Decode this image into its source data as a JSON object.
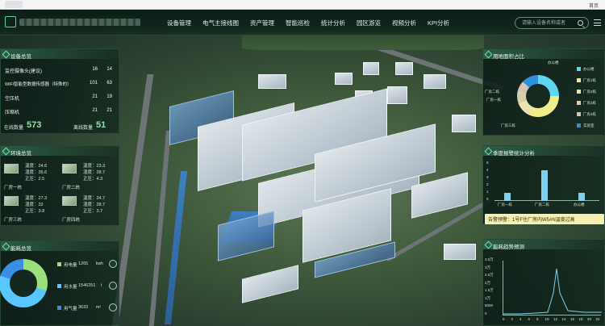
{
  "browser": {
    "tab_right": "首页"
  },
  "header": {
    "nav": [
      "设备管理",
      "电气主接线图",
      "资产管理",
      "智能巡检",
      "统计分析",
      "园区游览",
      "视频分析",
      "KPI分析"
    ],
    "search_placeholder": "请输入设备名称或者"
  },
  "device_panel": {
    "title": "设备总览",
    "rows": [
      {
        "label": "监控摄像头(建议)",
        "a": "16",
        "b": "14"
      },
      {
        "label": "WiFi智能型数据传感器（特殊的）",
        "a": "101",
        "b": "63"
      },
      {
        "label": "空压机",
        "a": "21",
        "b": "19"
      },
      {
        "label": "压缩机",
        "a": "21",
        "b": "21"
      }
    ],
    "online_label": "在线数量",
    "online_value": "573",
    "offline_label": "离线数量",
    "offline_value": "51"
  },
  "env_panel": {
    "title": "环境总览",
    "items": [
      {
        "name": "厂房一栋",
        "temp": "温度：24.6",
        "hum": "湿度：35.6",
        "pm": "正压：2.5"
      },
      {
        "name": "厂房二栋",
        "temp": "温度：23.3",
        "hum": "湿度：28.7",
        "pm": "正压：4.3"
      },
      {
        "name": "厂房三栋",
        "temp": "温度：27.3",
        "hum": "湿度：32",
        "pm": "正压：3.8"
      },
      {
        "name": "厂房四栋",
        "temp": "温度：24.7",
        "hum": "湿度：28.7",
        "pm": "正压：3.7"
      }
    ]
  },
  "energy_panel": {
    "title": "能耗总览",
    "items": [
      {
        "label": "用电量",
        "value": "1265",
        "unit": "kwh",
        "color": "#9be07a"
      },
      {
        "label": "用水量",
        "value": "1546251",
        "unit": "t",
        "color": "#58c7ff"
      },
      {
        "label": "用气量",
        "value": "3633",
        "unit": "m³",
        "color": "#3a8ee6"
      }
    ]
  },
  "usage_panel": {
    "title": "用地面积占比",
    "callouts": [
      "办公楼",
      "厂房二栋",
      "厂房一栋",
      "厂房三栋"
    ],
    "legend": [
      {
        "label": "办公楼",
        "color": "#5fd7f0"
      },
      {
        "label": "厂房1栋",
        "color": "#f0ec8a"
      },
      {
        "label": "厂房2栋",
        "color": "#eae4b0"
      },
      {
        "label": "厂房3栋",
        "color": "#d8d0a8"
      },
      {
        "label": "厂房4栋",
        "color": "#cfc7b4"
      },
      {
        "label": "实验室",
        "color": "#2f8fd8"
      }
    ],
    "shares": [
      0.25,
      0.32,
      0.12,
      0.1,
      0.08,
      0.13
    ]
  },
  "alarm_panel": {
    "title": "季度报警统计分析",
    "categories": [
      "厂房一栋",
      "厂房二栋",
      "办公楼"
    ],
    "y_ticks": [
      "5",
      "4",
      "3",
      "2",
      "1",
      "0"
    ],
    "series": [
      {
        "values": [
          1,
          4,
          1
        ]
      },
      {
        "values": [
          0,
          0,
          0
        ]
      }
    ],
    "alert_text": "告警预警：1号F住厂房内W5#N温度过高"
  },
  "trend_panel": {
    "title": "能耗趋势预测",
    "y_ticks": [
      "3.5万",
      "3万",
      "2.5万",
      "2万",
      "1.5万",
      "1万",
      "5000",
      "0"
    ],
    "x_ticks": [
      "0",
      "2",
      "4",
      "6",
      "8",
      "10",
      "12",
      "14",
      "16",
      "18",
      "20",
      "22"
    ]
  }
}
